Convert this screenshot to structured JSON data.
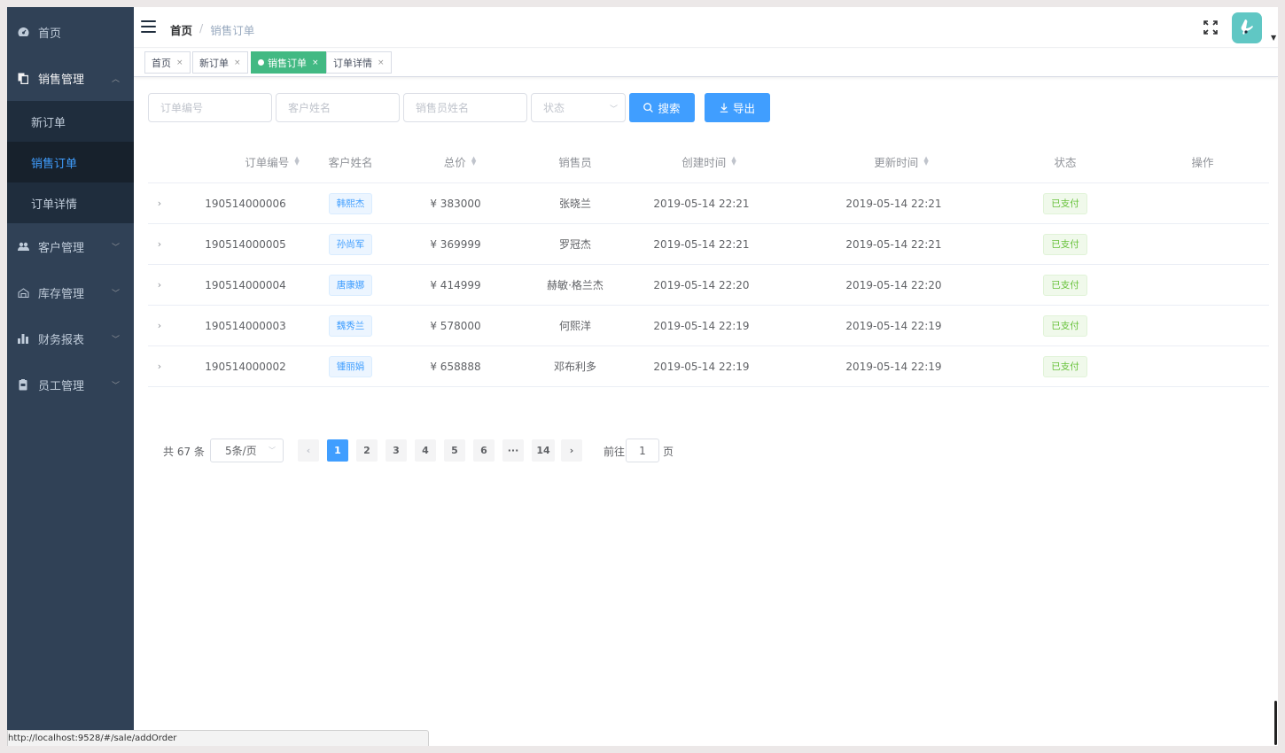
{
  "sidebar": {
    "items": [
      {
        "label": "首页",
        "icon": "dashboard-icon"
      },
      {
        "label": "销售管理",
        "icon": "copy-icon",
        "open": true,
        "children": [
          {
            "label": "新订单"
          },
          {
            "label": "销售订单",
            "active": true
          },
          {
            "label": "订单详情"
          }
        ]
      },
      {
        "label": "客户管理",
        "icon": "users-icon"
      },
      {
        "label": "库存管理",
        "icon": "warehouse-icon"
      },
      {
        "label": "财务报表",
        "icon": "bar-chart-icon"
      },
      {
        "label": "员工管理",
        "icon": "badge-icon"
      }
    ]
  },
  "header": {
    "breadcrumb": [
      "首页",
      "销售订单"
    ],
    "breadcrumb_sep": "/"
  },
  "tags": [
    {
      "label": "首页"
    },
    {
      "label": "新订单"
    },
    {
      "label": "销售订单",
      "active": true
    },
    {
      "label": "订单详情"
    }
  ],
  "filters": {
    "order_no_placeholder": "订单编号",
    "customer_placeholder": "客户姓名",
    "salesman_placeholder": "销售员姓名",
    "status_placeholder": "状态",
    "search_label": "搜索",
    "export_label": "导出"
  },
  "table": {
    "columns": [
      "订单编号",
      "客户姓名",
      "总价",
      "销售员",
      "创建时间",
      "更新时间",
      "状态",
      "操作"
    ],
    "rows": [
      {
        "order_no": "190514000006",
        "customer": "韩熙杰",
        "total": "¥ 383000",
        "salesman": "张晓兰",
        "created": "2019-05-14 22:21",
        "updated": "2019-05-14 22:21",
        "status": "已支付"
      },
      {
        "order_no": "190514000005",
        "customer": "孙尚军",
        "total": "¥ 369999",
        "salesman": "罗冠杰",
        "created": "2019-05-14 22:21",
        "updated": "2019-05-14 22:21",
        "status": "已支付"
      },
      {
        "order_no": "190514000004",
        "customer": "唐康娜",
        "total": "¥ 414999",
        "salesman": "赫敏·格兰杰",
        "created": "2019-05-14 22:20",
        "updated": "2019-05-14 22:20",
        "status": "已支付"
      },
      {
        "order_no": "190514000003",
        "customer": "魏秀兰",
        "total": "¥ 578000",
        "salesman": "何熙洋",
        "created": "2019-05-14 22:19",
        "updated": "2019-05-14 22:19",
        "status": "已支付"
      },
      {
        "order_no": "190514000002",
        "customer": "锺丽娟",
        "total": "¥ 658888",
        "salesman": "邓布利多",
        "created": "2019-05-14 22:19",
        "updated": "2019-05-14 22:19",
        "status": "已支付"
      }
    ]
  },
  "pagination": {
    "total_text": "共 67 条",
    "page_size": "5条/页",
    "pages": [
      "1",
      "2",
      "3",
      "4",
      "5",
      "6",
      "···",
      "14"
    ],
    "current": "1",
    "goto_label": "前往",
    "goto_value": "1",
    "page_suffix": "页"
  },
  "statusbar": {
    "url": "http://localhost:9528/#/sale/addOrder"
  },
  "colors": {
    "sidebar_bg": "#304156",
    "primary": "#409eff",
    "tag_active": "#42b983",
    "success": "#67c23a"
  }
}
